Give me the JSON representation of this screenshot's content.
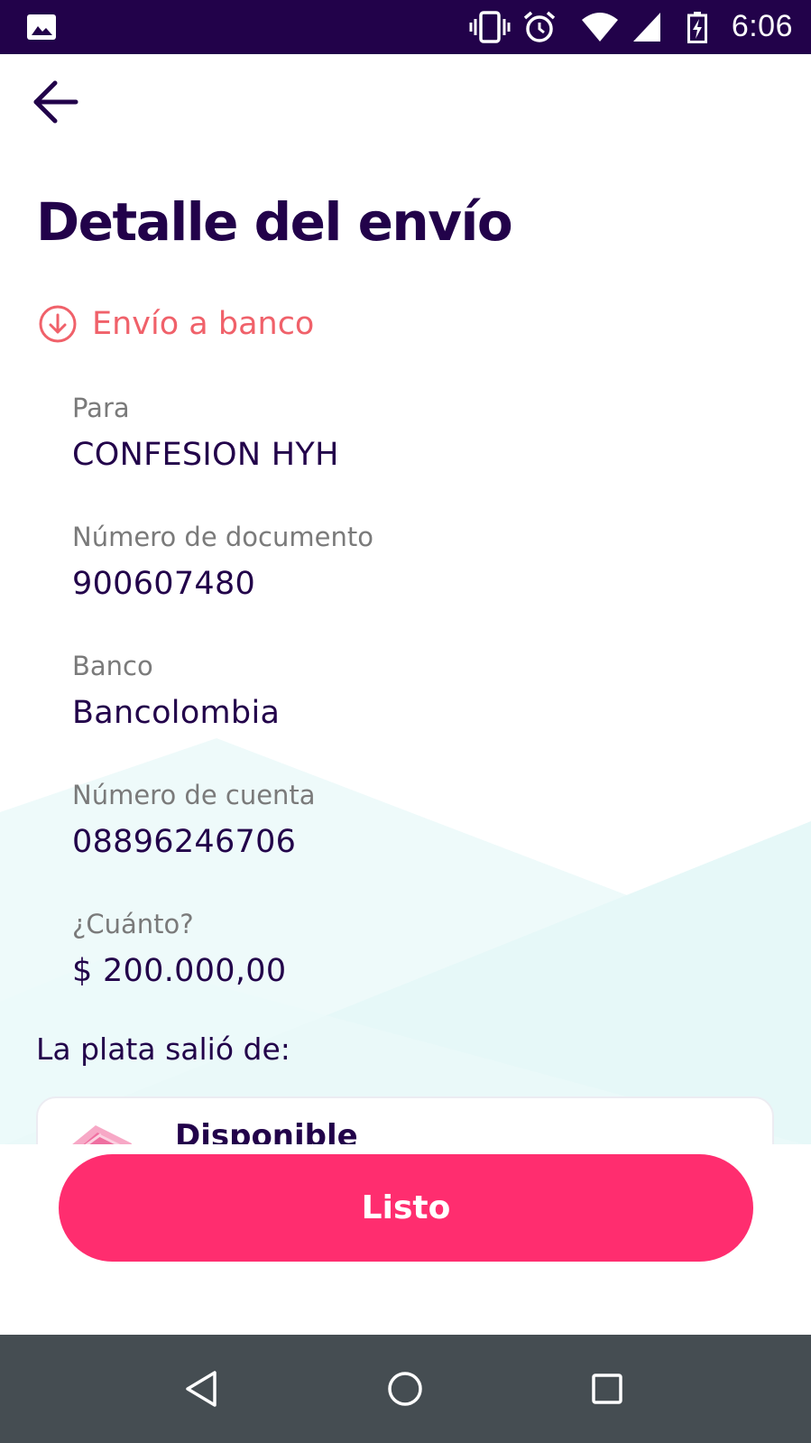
{
  "status_bar": {
    "time": "6:06",
    "icons": [
      "image-notification-icon",
      "vibrate-icon",
      "alarm-icon",
      "wifi-icon",
      "signal-icon",
      "battery-charging-icon"
    ]
  },
  "header": {
    "back_icon": "arrow-left-icon",
    "title": "Detalle del envío"
  },
  "transfer": {
    "type_icon": "arrow-down-circle-icon",
    "type_label": "Envío a banco"
  },
  "details": [
    {
      "label": "Para",
      "value": "CONFESION HYH"
    },
    {
      "label": "Número de documento",
      "value": "900607480"
    },
    {
      "label": "Banco",
      "value": "Bancolombia"
    },
    {
      "label": "Número de cuenta",
      "value": "08896246706"
    },
    {
      "label": "¿Cuánto?",
      "value": "$ 200.000,00"
    }
  ],
  "source": {
    "label": "La plata salió de:",
    "account_name": "Disponible",
    "account_icon": "pocket-card-icon"
  },
  "actions": {
    "done_label": "Listo"
  },
  "nav_bar": {
    "icons": [
      "back-triangle-icon",
      "home-circle-icon",
      "recents-square-icon"
    ]
  },
  "colors": {
    "primary_dark": "#22024a",
    "accent_pink": "#ff2d6f",
    "transfer_red": "#f0616a",
    "label_gray": "#7a7a7a",
    "nav_bar": "#454d52"
  }
}
